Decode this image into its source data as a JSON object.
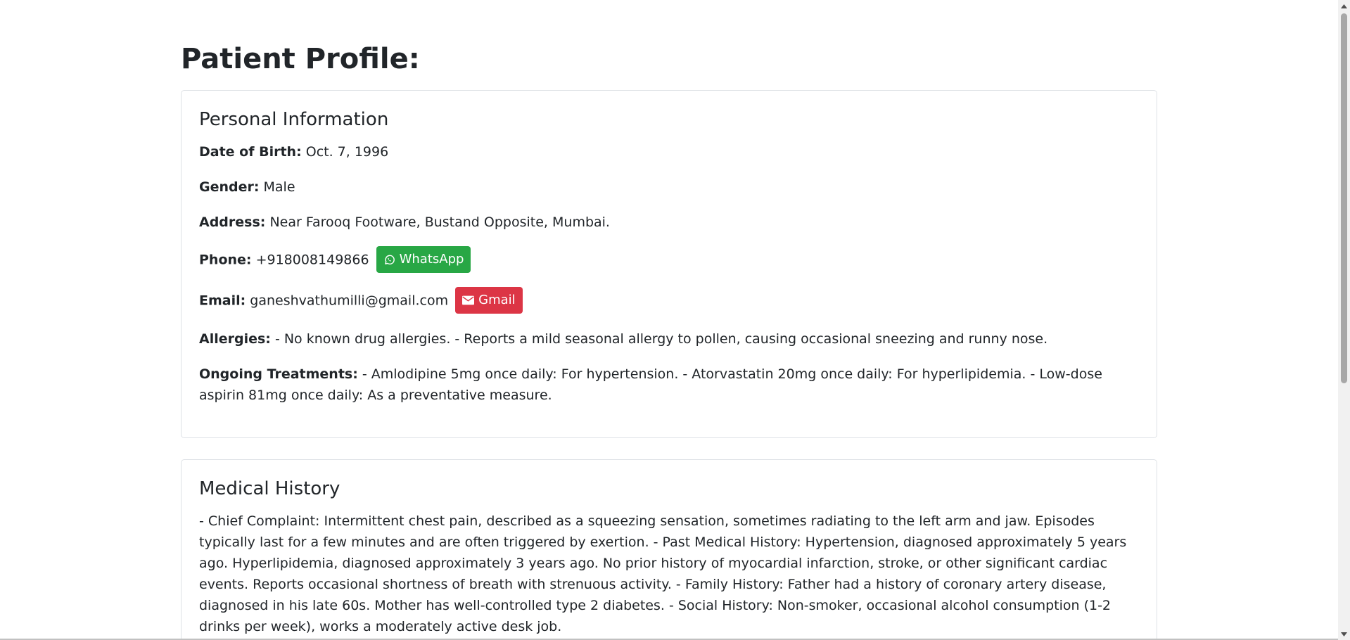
{
  "page": {
    "title": "Patient Profile:"
  },
  "personal": {
    "heading": "Personal Information",
    "dob": {
      "label": "Date of Birth:",
      "value": "Oct. 7, 1996"
    },
    "gender": {
      "label": "Gender:",
      "value": "Male"
    },
    "address": {
      "label": "Address:",
      "value": "Near Farooq Footware, Bustand Opposite, Mumbai."
    },
    "phone": {
      "label": "Phone:",
      "value": "+918008149866",
      "button_label": "WhatsApp",
      "button_icon": "whatsapp-icon",
      "button_color": "#28a745"
    },
    "email": {
      "label": "Email:",
      "value": "ganeshvathumilli@gmail.com",
      "button_label": "Gmail",
      "button_icon": "envelope-icon",
      "button_color": "#dc3545"
    },
    "allergies": {
      "label": "Allergies:",
      "value": "- No known drug allergies. - Reports a mild seasonal allergy to pollen, causing occasional sneezing and runny nose."
    },
    "treatments": {
      "label": "Ongoing Treatments:",
      "value": "- Amlodipine 5mg once daily: For hypertension. - Atorvastatin 20mg once daily: For hyperlipidemia. - Low-dose aspirin 81mg once daily: As a preventative measure."
    }
  },
  "history": {
    "heading": "Medical History",
    "text": "- Chief Complaint: Intermittent chest pain, described as a squeezing sensation, sometimes radiating to the left arm and jaw. Episodes typically last for a few minutes and are often triggered by exertion. - Past Medical History: Hypertension, diagnosed approximately 5 years ago. Hyperlipidemia, diagnosed approximately 3 years ago. No prior history of myocardial infarction, stroke, or other significant cardiac events. Reports occasional shortness of breath with strenuous activity. - Family History: Father had a history of coronary artery disease, diagnosed in his late 60s. Mother has well-controlled type 2 diabetes. - Social History: Non-smoker, occasional alcohol consumption (1-2 drinks per week), works a moderately active desk job."
  }
}
